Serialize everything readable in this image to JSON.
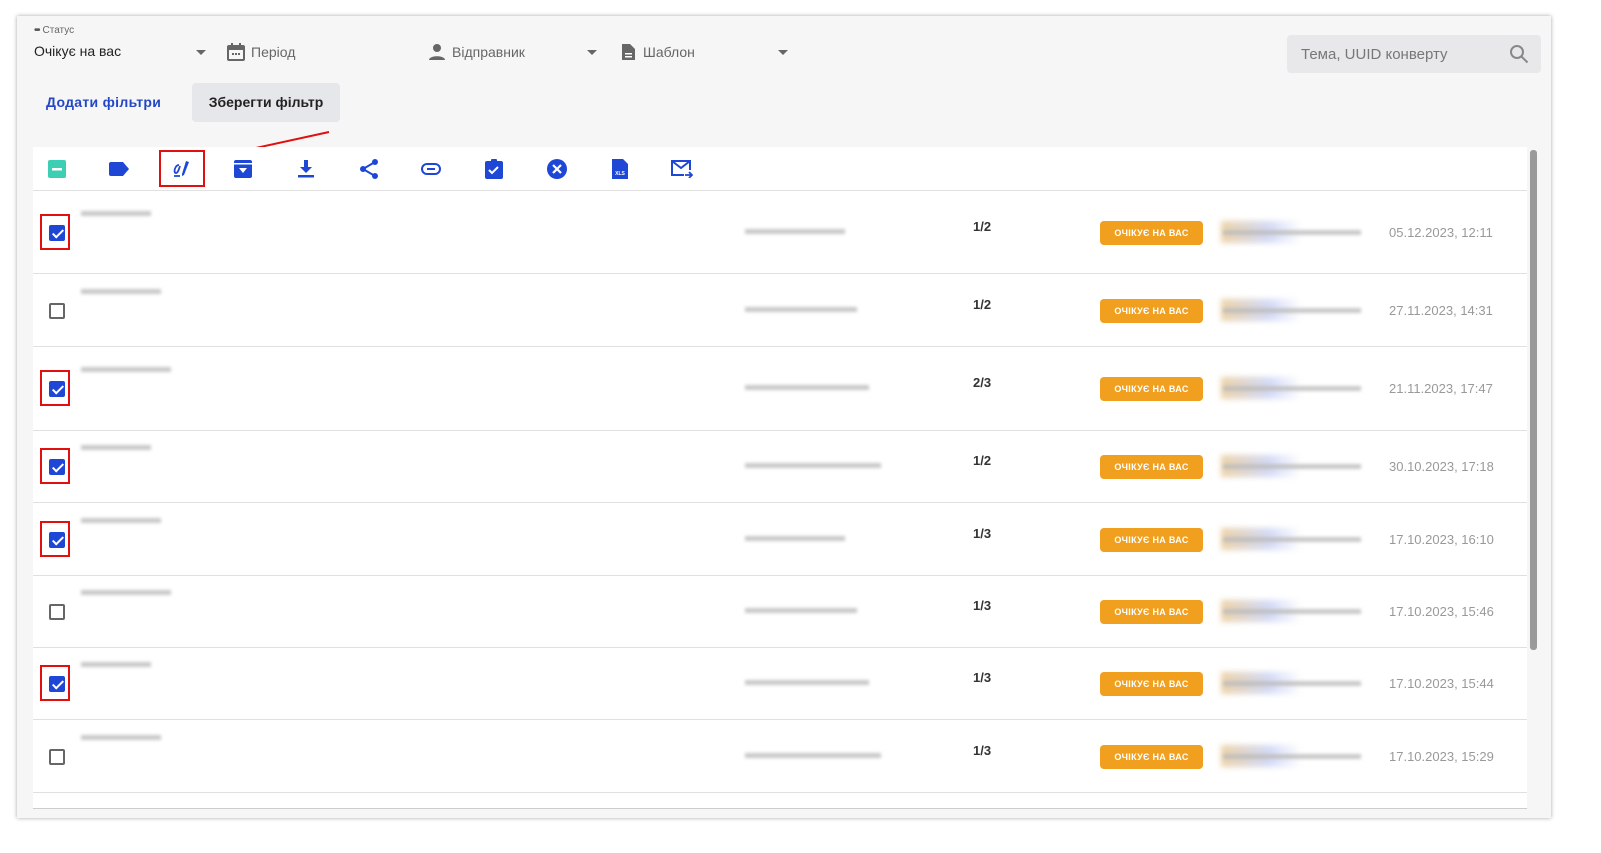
{
  "filters": {
    "status_label": "Статус",
    "status_value": "Очікує на вас",
    "period": "Період",
    "sender": "Відправник",
    "template": "Шаблон"
  },
  "search": {
    "placeholder": "Тема, UUID конверту"
  },
  "buttons": {
    "add_filters": "Додати фільтри",
    "save_filter": "Зберегти фільтр"
  },
  "toolbar": [
    "deselect-all",
    "tag",
    "sign",
    "archive",
    "download",
    "share",
    "link",
    "approve",
    "reject",
    "export-xls",
    "send-email"
  ],
  "toolbar_xls_label": "XLS",
  "accent": "#1f47d6",
  "badge_color": "#f0a01e",
  "rows": [
    {
      "checked": true,
      "ratio": "1/2",
      "status": "ОЧІКУЄ НА ВАС",
      "date": "05.12.2023, 12:11"
    },
    {
      "checked": false,
      "ratio": "1/2",
      "status": "ОЧІКУЄ НА ВАС",
      "date": "27.11.2023, 14:31"
    },
    {
      "checked": true,
      "ratio": "2/3",
      "status": "ОЧІКУЄ НА ВАС",
      "date": "21.11.2023, 17:47"
    },
    {
      "checked": true,
      "ratio": "1/2",
      "status": "ОЧІКУЄ НА ВАС",
      "date": "30.10.2023, 17:18"
    },
    {
      "checked": true,
      "ratio": "1/3",
      "status": "ОЧІКУЄ НА ВАС",
      "date": "17.10.2023, 16:10"
    },
    {
      "checked": false,
      "ratio": "1/3",
      "status": "ОЧІКУЄ НА ВАС",
      "date": "17.10.2023, 15:46"
    },
    {
      "checked": true,
      "ratio": "1/3",
      "status": "ОЧІКУЄ НА ВАС",
      "date": "17.10.2023, 15:44"
    },
    {
      "checked": false,
      "ratio": "1/3",
      "status": "ОЧІКУЄ НА ВАС",
      "date": "17.10.2023, 15:29"
    }
  ]
}
